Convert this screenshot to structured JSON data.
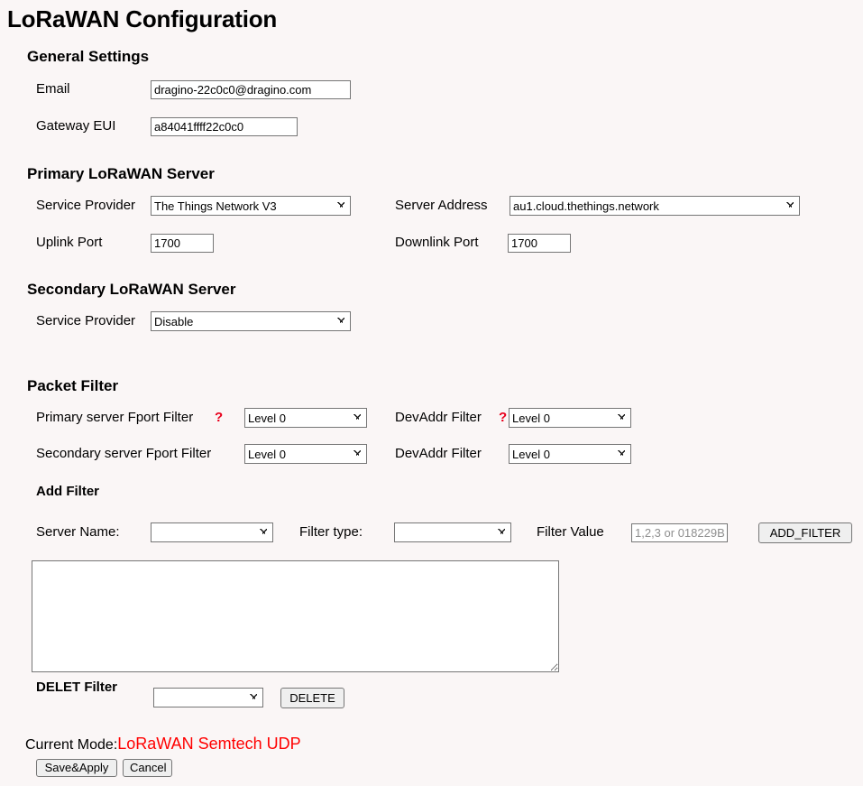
{
  "page": {
    "title": "LoRaWAN Configuration",
    "background_color": "#faf6f6",
    "accent_red": "#ff0000",
    "help_marker_color": "#e8001c"
  },
  "general_settings": {
    "heading": "General Settings",
    "email": {
      "label": "Email",
      "value": "dragino-22c0c0@dragino.com"
    },
    "gateway_eui": {
      "label": "Gateway EUI",
      "value": "a84041ffff22c0c0"
    }
  },
  "primary_server": {
    "heading": "Primary LoRaWAN Server",
    "service_provider": {
      "label": "Service Provider",
      "value": "The Things Network V3",
      "options": [
        "The Things Network V3"
      ]
    },
    "server_address": {
      "label": "Server Address",
      "value": "au1.cloud.thethings.network",
      "options": [
        "au1.cloud.thethings.network"
      ]
    },
    "uplink_port": {
      "label": "Uplink Port",
      "value": "1700"
    },
    "downlink_port": {
      "label": "Downlink Port",
      "value": "1700"
    }
  },
  "secondary_server": {
    "heading": "Secondary LoRaWAN Server",
    "service_provider": {
      "label": "Service Provider",
      "value": "Disable",
      "options": [
        "Disable"
      ]
    }
  },
  "packet_filter": {
    "heading": "Packet Filter",
    "help_marker": "?",
    "primary_fport": {
      "label": "Primary server Fport Filter",
      "value": "Level 0",
      "options": [
        "Level 0"
      ]
    },
    "primary_devaddr": {
      "label": "DevAddr Filter",
      "value": "Level 0",
      "options": [
        "Level 0"
      ]
    },
    "secondary_fport": {
      "label": "Secondary server Fport Filter",
      "value": "Level 0",
      "options": [
        "Level 0"
      ]
    },
    "secondary_devaddr": {
      "label": "DevAddr Filter",
      "value": "Level 0",
      "options": [
        "Level 0"
      ]
    }
  },
  "add_filter": {
    "heading": "Add Filter",
    "server_name": {
      "label": "Server Name:",
      "value": "",
      "options": [
        ""
      ]
    },
    "filter_type": {
      "label": "Filter type:",
      "value": "",
      "options": [
        ""
      ]
    },
    "filter_value": {
      "label": "Filter Value",
      "value": "",
      "placeholder": "1,2,3 or 018229B"
    },
    "add_button": "ADD_FILTER"
  },
  "filter_list": {
    "value": ""
  },
  "delete_filter": {
    "heading": "DELET Filter",
    "select": {
      "value": "",
      "options": [
        ""
      ]
    },
    "delete_button": "DELETE"
  },
  "footer": {
    "current_mode_label": "Current Mode:",
    "current_mode_value": "LoRaWAN Semtech UDP",
    "save_button": "Save&Apply",
    "cancel_button": "Cancel"
  }
}
